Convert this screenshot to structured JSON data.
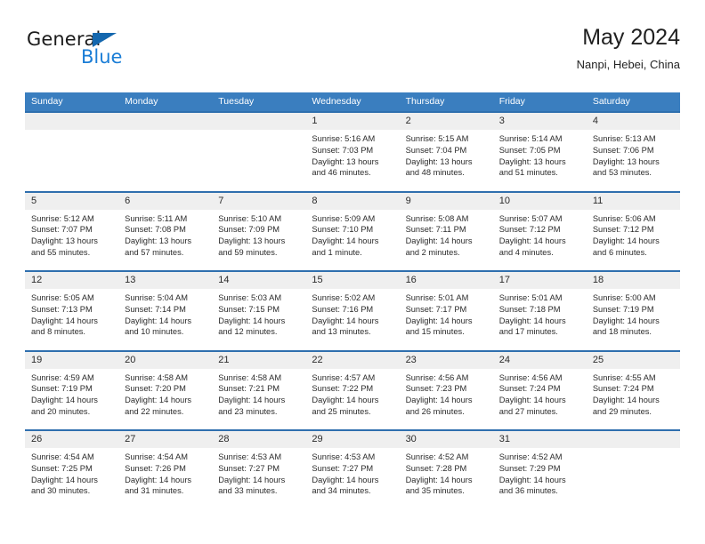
{
  "logo": {
    "text_top": "General",
    "text_bottom": "Blue",
    "triangle_color": "#1467ae",
    "blue_color": "#1a7dd6"
  },
  "header": {
    "title": "May 2024",
    "subtitle": "Nanpi, Hebei, China"
  },
  "theme": {
    "header_blue": "#3a7ebf",
    "row_rule_blue": "#2f6fae",
    "day_band_gray": "#efefef"
  },
  "weekdays": [
    "Sunday",
    "Monday",
    "Tuesday",
    "Wednesday",
    "Thursday",
    "Friday",
    "Saturday"
  ],
  "weeks": [
    [
      {
        "day": ""
      },
      {
        "day": ""
      },
      {
        "day": ""
      },
      {
        "day": "1",
        "sunrise": "Sunrise: 5:16 AM",
        "sunset": "Sunset: 7:03 PM",
        "daylight": "Daylight: 13 hours and 46 minutes."
      },
      {
        "day": "2",
        "sunrise": "Sunrise: 5:15 AM",
        "sunset": "Sunset: 7:04 PM",
        "daylight": "Daylight: 13 hours and 48 minutes."
      },
      {
        "day": "3",
        "sunrise": "Sunrise: 5:14 AM",
        "sunset": "Sunset: 7:05 PM",
        "daylight": "Daylight: 13 hours and 51 minutes."
      },
      {
        "day": "4",
        "sunrise": "Sunrise: 5:13 AM",
        "sunset": "Sunset: 7:06 PM",
        "daylight": "Daylight: 13 hours and 53 minutes."
      }
    ],
    [
      {
        "day": "5",
        "sunrise": "Sunrise: 5:12 AM",
        "sunset": "Sunset: 7:07 PM",
        "daylight": "Daylight: 13 hours and 55 minutes."
      },
      {
        "day": "6",
        "sunrise": "Sunrise: 5:11 AM",
        "sunset": "Sunset: 7:08 PM",
        "daylight": "Daylight: 13 hours and 57 minutes."
      },
      {
        "day": "7",
        "sunrise": "Sunrise: 5:10 AM",
        "sunset": "Sunset: 7:09 PM",
        "daylight": "Daylight: 13 hours and 59 minutes."
      },
      {
        "day": "8",
        "sunrise": "Sunrise: 5:09 AM",
        "sunset": "Sunset: 7:10 PM",
        "daylight": "Daylight: 14 hours and 1 minute."
      },
      {
        "day": "9",
        "sunrise": "Sunrise: 5:08 AM",
        "sunset": "Sunset: 7:11 PM",
        "daylight": "Daylight: 14 hours and 2 minutes."
      },
      {
        "day": "10",
        "sunrise": "Sunrise: 5:07 AM",
        "sunset": "Sunset: 7:12 PM",
        "daylight": "Daylight: 14 hours and 4 minutes."
      },
      {
        "day": "11",
        "sunrise": "Sunrise: 5:06 AM",
        "sunset": "Sunset: 7:12 PM",
        "daylight": "Daylight: 14 hours and 6 minutes."
      }
    ],
    [
      {
        "day": "12",
        "sunrise": "Sunrise: 5:05 AM",
        "sunset": "Sunset: 7:13 PM",
        "daylight": "Daylight: 14 hours and 8 minutes."
      },
      {
        "day": "13",
        "sunrise": "Sunrise: 5:04 AM",
        "sunset": "Sunset: 7:14 PM",
        "daylight": "Daylight: 14 hours and 10 minutes."
      },
      {
        "day": "14",
        "sunrise": "Sunrise: 5:03 AM",
        "sunset": "Sunset: 7:15 PM",
        "daylight": "Daylight: 14 hours and 12 minutes."
      },
      {
        "day": "15",
        "sunrise": "Sunrise: 5:02 AM",
        "sunset": "Sunset: 7:16 PM",
        "daylight": "Daylight: 14 hours and 13 minutes."
      },
      {
        "day": "16",
        "sunrise": "Sunrise: 5:01 AM",
        "sunset": "Sunset: 7:17 PM",
        "daylight": "Daylight: 14 hours and 15 minutes."
      },
      {
        "day": "17",
        "sunrise": "Sunrise: 5:01 AM",
        "sunset": "Sunset: 7:18 PM",
        "daylight": "Daylight: 14 hours and 17 minutes."
      },
      {
        "day": "18",
        "sunrise": "Sunrise: 5:00 AM",
        "sunset": "Sunset: 7:19 PM",
        "daylight": "Daylight: 14 hours and 18 minutes."
      }
    ],
    [
      {
        "day": "19",
        "sunrise": "Sunrise: 4:59 AM",
        "sunset": "Sunset: 7:19 PM",
        "daylight": "Daylight: 14 hours and 20 minutes."
      },
      {
        "day": "20",
        "sunrise": "Sunrise: 4:58 AM",
        "sunset": "Sunset: 7:20 PM",
        "daylight": "Daylight: 14 hours and 22 minutes."
      },
      {
        "day": "21",
        "sunrise": "Sunrise: 4:58 AM",
        "sunset": "Sunset: 7:21 PM",
        "daylight": "Daylight: 14 hours and 23 minutes."
      },
      {
        "day": "22",
        "sunrise": "Sunrise: 4:57 AM",
        "sunset": "Sunset: 7:22 PM",
        "daylight": "Daylight: 14 hours and 25 minutes."
      },
      {
        "day": "23",
        "sunrise": "Sunrise: 4:56 AM",
        "sunset": "Sunset: 7:23 PM",
        "daylight": "Daylight: 14 hours and 26 minutes."
      },
      {
        "day": "24",
        "sunrise": "Sunrise: 4:56 AM",
        "sunset": "Sunset: 7:24 PM",
        "daylight": "Daylight: 14 hours and 27 minutes."
      },
      {
        "day": "25",
        "sunrise": "Sunrise: 4:55 AM",
        "sunset": "Sunset: 7:24 PM",
        "daylight": "Daylight: 14 hours and 29 minutes."
      }
    ],
    [
      {
        "day": "26",
        "sunrise": "Sunrise: 4:54 AM",
        "sunset": "Sunset: 7:25 PM",
        "daylight": "Daylight: 14 hours and 30 minutes."
      },
      {
        "day": "27",
        "sunrise": "Sunrise: 4:54 AM",
        "sunset": "Sunset: 7:26 PM",
        "daylight": "Daylight: 14 hours and 31 minutes."
      },
      {
        "day": "28",
        "sunrise": "Sunrise: 4:53 AM",
        "sunset": "Sunset: 7:27 PM",
        "daylight": "Daylight: 14 hours and 33 minutes."
      },
      {
        "day": "29",
        "sunrise": "Sunrise: 4:53 AM",
        "sunset": "Sunset: 7:27 PM",
        "daylight": "Daylight: 14 hours and 34 minutes."
      },
      {
        "day": "30",
        "sunrise": "Sunrise: 4:52 AM",
        "sunset": "Sunset: 7:28 PM",
        "daylight": "Daylight: 14 hours and 35 minutes."
      },
      {
        "day": "31",
        "sunrise": "Sunrise: 4:52 AM",
        "sunset": "Sunset: 7:29 PM",
        "daylight": "Daylight: 14 hours and 36 minutes."
      },
      {
        "day": ""
      }
    ]
  ]
}
